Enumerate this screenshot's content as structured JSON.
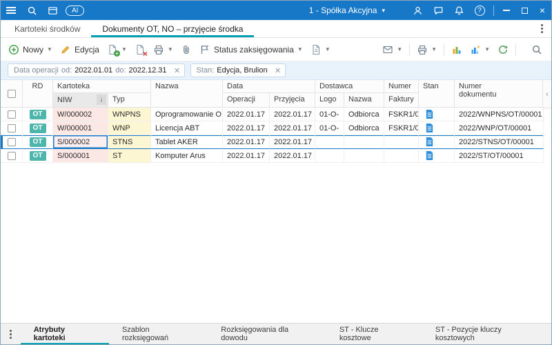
{
  "titlebar": {
    "company": "1 - Spółka Akcyjna",
    "ai_badge": "AI"
  },
  "doc_tabs": {
    "items": [
      "Kartoteki środków",
      "Dokumenty OT, NO – przyjęcie środka"
    ]
  },
  "toolbar": {
    "new_label": "Nowy",
    "edit_label": "Edycja",
    "status_label": "Status zaksięgowania"
  },
  "filterbar": {
    "date_chip": {
      "label": "Data operacji",
      "from_label": "od:",
      "from_value": "2022.01.01",
      "to_label": "do:",
      "to_value": "2022.12.31"
    },
    "state_chip": {
      "label": "Stan:",
      "value": "Edycja, Brulion"
    }
  },
  "table": {
    "h": {
      "rd": "RD",
      "kartoteka": "Kartoteka",
      "niw": "NIW",
      "typ": "Typ",
      "nazwa": "Nazwa",
      "data": "Data",
      "operacji": "Operacji",
      "przyjecia": "Przyjęcia",
      "dostawca": "Dostawca",
      "logo": "Logo",
      "dostawca_nazwa": "Nazwa",
      "numer": "Numer",
      "faktury": "Faktury",
      "stan": "Stan",
      "numer_dok_1": "Numer",
      "numer_dok_2": "dokumentu"
    },
    "rows": [
      {
        "rd": "OT",
        "niw": "W/000002",
        "typ": "WNPNS",
        "nazwa": "Oprogramowanie O",
        "operacji": "2022.01.17",
        "przyjecia": "2022.01.17",
        "logo": "01-O-",
        "dostawca": "Odbiorca",
        "faktura": "FSKR1/0",
        "dokument": "2022/WNPNS/OT/00001"
      },
      {
        "rd": "OT",
        "niw": "W/000001",
        "typ": "WNP",
        "nazwa": "Licencja ABT",
        "operacji": "2022.01.17",
        "przyjecia": "2022.01.17",
        "logo": "01-O-",
        "dostawca": "Odbiorca",
        "faktura": "FSKR1/0",
        "dokument": "2022/WNP/OT/00001"
      },
      {
        "rd": "OT",
        "niw": "S/000002",
        "typ": "STNS",
        "nazwa": "Tablet AKER",
        "operacji": "2022.01.17",
        "przyjecia": "2022.01.17",
        "logo": "",
        "dostawca": "",
        "faktura": "",
        "dokument": "2022/STNS/OT/00001"
      },
      {
        "rd": "OT",
        "niw": "S/000001",
        "typ": "ST",
        "nazwa": "Komputer Arus",
        "operacji": "2022.01.17",
        "przyjecia": "2022.01.17",
        "logo": "",
        "dostawca": "",
        "faktura": "",
        "dokument": "2022/ST/OT/00001"
      }
    ]
  },
  "bottom_tabs": [
    "Atrybuty kartoteki",
    "Szablon rozksięgowań",
    "Rozksięgowania dla dowodu",
    "ST - Klucze kosztowe",
    "ST - Pozycje kluczy kosztowych"
  ],
  "icons": {
    "titlebar": [
      "menu-icon",
      "search-icon",
      "panels-icon",
      "ai-badge",
      "chevron-down-icon",
      "user-icon",
      "chat-icon",
      "bell-icon",
      "help-icon",
      "minimize-icon",
      "maximize-icon",
      "close-icon"
    ],
    "toolbar": [
      "new-plus-icon",
      "edit-pencil-icon",
      "new-document-icon",
      "delete-document-icon",
      "print-icon",
      "attachment-icon",
      "posting-status-flag-icon",
      "document-menu-icon",
      "envelope-icon",
      "export-print-icon",
      "bar-chart-icon",
      "chart-wizard-icon",
      "refresh-icon",
      "search-icon"
    ],
    "table": [
      "sort-desc-icon",
      "document-state-icon",
      "collapse-panel-icon"
    ],
    "bottom": [
      "kebab-icon"
    ]
  },
  "colors": {
    "titlebar_blue": "#1878c8",
    "accent_teal": "#00a0b4",
    "ot_badge": "#4db6ac",
    "niw_pink": "#fbe7e4",
    "typ_yellow": "#fcf6d2",
    "selection_blue": "#1878c8",
    "doc_icon_blue": "#2f8fdd"
  }
}
